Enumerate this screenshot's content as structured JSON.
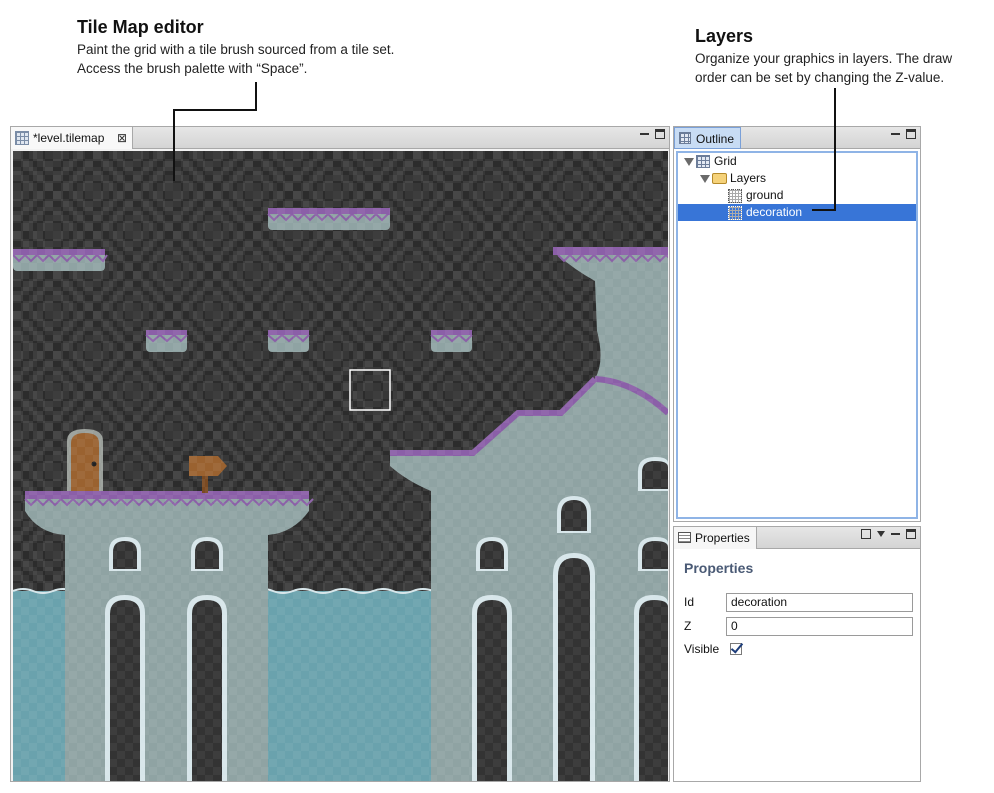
{
  "callouts": {
    "tilemap": {
      "title": "Tile Map editor",
      "line1": "Paint the grid with a tile brush sourced from a tile set.",
      "line2": "Access the brush palette with “Space”."
    },
    "layers": {
      "title": "Layers",
      "line1": "Organize your graphics in layers. The draw",
      "line2": "order can be set by changing the Z-value."
    }
  },
  "editor": {
    "tab_label": "*level.tilemap",
    "tab_icon": "tilemap-icon",
    "close_icon": "close-icon"
  },
  "outline": {
    "tab_label": "Outline",
    "tree": {
      "root": "Grid",
      "folder": "Layers",
      "children": [
        "ground",
        "decoration"
      ],
      "selected": "decoration"
    }
  },
  "properties": {
    "tab_label": "Properties",
    "title": "Properties",
    "id_label": "Id",
    "id_value": "decoration",
    "z_label": "Z",
    "z_value": "0",
    "visible_label": "Visible",
    "visible_checked": true
  },
  "colors": {
    "selection": "#3875d7",
    "water": "#6aa2ad",
    "stone": "#8fa3a3",
    "grass_top": "#8b5fa8"
  }
}
